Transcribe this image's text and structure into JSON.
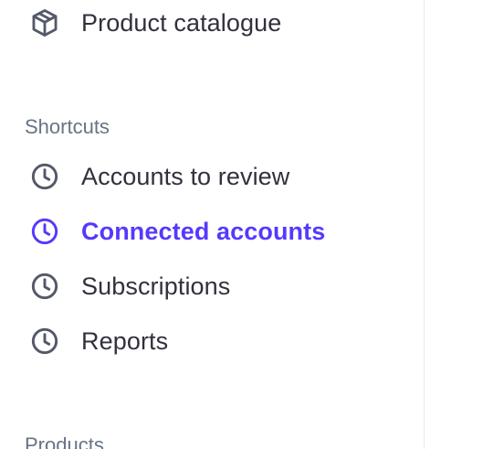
{
  "sidebar": {
    "top_item": {
      "label": "Product catalogue",
      "icon": "package-icon"
    },
    "shortcuts": {
      "header": "Shortcuts",
      "items": [
        {
          "label": "Accounts to review",
          "icon": "clock-icon",
          "active": false
        },
        {
          "label": "Connected accounts",
          "icon": "clock-icon",
          "active": true
        },
        {
          "label": "Subscriptions",
          "icon": "clock-icon",
          "active": false
        },
        {
          "label": "Reports",
          "icon": "clock-icon",
          "active": false
        }
      ]
    },
    "products_header": "Products"
  },
  "colors": {
    "text": "#30313d",
    "icon": "#545969",
    "active": "#533afd",
    "section_header": "#687385",
    "divider": "#e6e8ec"
  }
}
